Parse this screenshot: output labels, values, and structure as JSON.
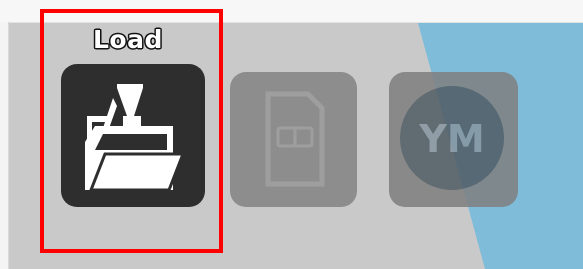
{
  "toolbar": {
    "load_label": "Load",
    "buttons": [
      {
        "id": "load",
        "icon": "folder-load-icon",
        "state": "enabled"
      },
      {
        "id": "sd",
        "icon": "sd-card-icon",
        "icon_text": "SD",
        "state": "disabled"
      },
      {
        "id": "ym",
        "icon": "ym-circle-icon",
        "icon_text": "YM",
        "state": "disabled"
      }
    ]
  },
  "colors": {
    "background_gray": "#c9c9c9",
    "background_blue": "#7fbcd9",
    "active_tile": "#2e2e2e",
    "disabled_tile": "#8a8a8a",
    "highlight_border": "#ff0000"
  }
}
